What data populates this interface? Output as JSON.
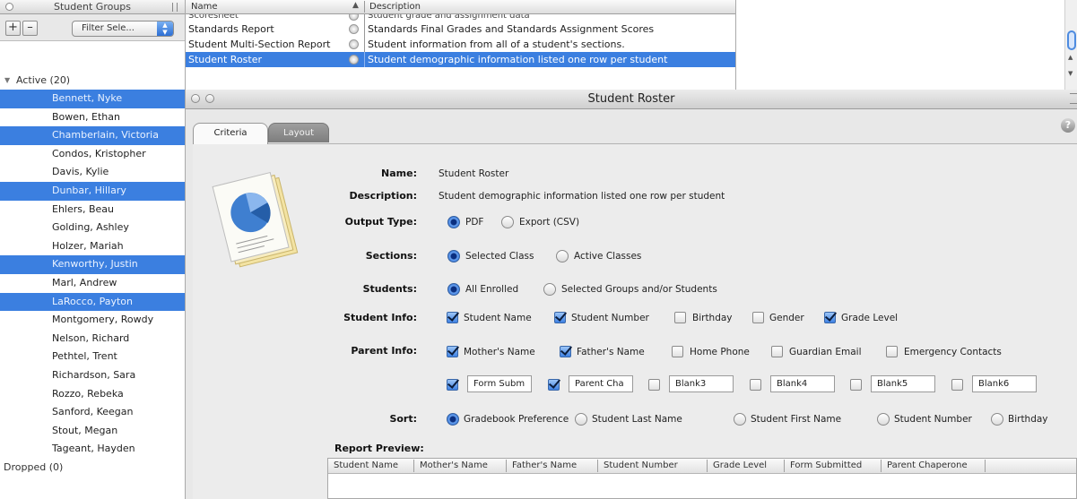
{
  "sidebar": {
    "title": "Student Groups",
    "add_label": "+",
    "remove_label": "–",
    "filter_value": "Filter Sele...",
    "groups": [
      {
        "label": "Active (20)"
      },
      {
        "label": "Dropped (0)"
      }
    ],
    "students": [
      {
        "name": "Bennett, Nyke",
        "selected": true
      },
      {
        "name": "Bowen, Ethan",
        "selected": false
      },
      {
        "name": "Chamberlain, Victoria",
        "selected": true
      },
      {
        "name": "Condos, Kristopher",
        "selected": false
      },
      {
        "name": "Davis, Kylie",
        "selected": false
      },
      {
        "name": "Dunbar, Hillary",
        "selected": true
      },
      {
        "name": "Ehlers, Beau",
        "selected": false
      },
      {
        "name": "Golding, Ashley",
        "selected": false
      },
      {
        "name": "Holzer, Mariah",
        "selected": false
      },
      {
        "name": "Kenworthy, Justin",
        "selected": true
      },
      {
        "name": "Marl, Andrew",
        "selected": false
      },
      {
        "name": "LaRocco, Payton",
        "selected": true
      },
      {
        "name": "Montgomery, Rowdy",
        "selected": false
      },
      {
        "name": "Nelson, Richard",
        "selected": false
      },
      {
        "name": "Pethtel, Trent",
        "selected": false
      },
      {
        "name": "Richardson, Sara",
        "selected": false
      },
      {
        "name": "Rozzo, Rebeka",
        "selected": false
      },
      {
        "name": "Sanford, Keegan",
        "selected": false
      },
      {
        "name": "Stout, Megan",
        "selected": false
      },
      {
        "name": "Tageant, Hayden",
        "selected": false
      }
    ]
  },
  "report_list": {
    "col_name": "Name",
    "col_desc": "Description",
    "sort_indicator": "▲",
    "rows": [
      {
        "name": "Scoresheet",
        "desc": "Student grade and assignment data",
        "cut": true,
        "selected": false
      },
      {
        "name": "Standards Report",
        "desc": "Standards Final Grades and Standards Assignment Scores",
        "selected": false
      },
      {
        "name": "Student Multi-Section Report",
        "desc": "Student information from all of a student's sections.",
        "selected": false
      },
      {
        "name": "Student Roster",
        "desc": "Student demographic information listed one row per student",
        "selected": true
      }
    ]
  },
  "report_window": {
    "title": "Student Roster",
    "help_label": "?",
    "tabs": {
      "criteria": "Criteria",
      "layout": "Layout"
    },
    "name_label": "Name:",
    "name_value": "Student Roster",
    "desc_label": "Description:",
    "desc_value": "Student demographic information listed one row per student",
    "output_label": "Output Type:",
    "output_pdf": "PDF",
    "output_csv": "Export (CSV)",
    "sections_label": "Sections:",
    "sections_selected": "Selected Class",
    "sections_active": "Active Classes",
    "students_label": "Students:",
    "students_all": "All Enrolled",
    "students_groups": "Selected Groups and/or Students",
    "student_info_label": "Student Info:",
    "student_info": {
      "name": "Student Name",
      "number": "Student Number",
      "birthday": "Birthday",
      "gender": "Gender",
      "grade": "Grade Level"
    },
    "parent_info_label": "Parent Info:",
    "parent_info": {
      "mother": "Mother's Name",
      "father": "Father's Name",
      "home_phone": "Home Phone",
      "guardian_email": "Guardian Email",
      "emergency": "Emergency Contacts"
    },
    "blanks": {
      "b1": "Form Subm",
      "b2": "Parent Cha",
      "b3": "Blank3",
      "b4": "Blank4",
      "b5": "Blank5",
      "b6": "Blank6"
    },
    "sort_label": "Sort:",
    "sort": {
      "gradebook": "Gradebook Preference",
      "last": "Student Last Name",
      "first": "Student First Name",
      "number": "Student Number",
      "birthday": "Birthday"
    },
    "preview_label": "Report Preview:",
    "preview_columns": {
      "c1": "Student Name",
      "c2": "Mother's Name",
      "c3": "Father's Name",
      "c4": "Student Number",
      "c5": "Grade Level",
      "c6": "Form Submitted",
      "c7": "Parent Chaperone"
    }
  },
  "colors": {
    "selection": "#3b7fe0",
    "window_bg": "#ececec"
  }
}
